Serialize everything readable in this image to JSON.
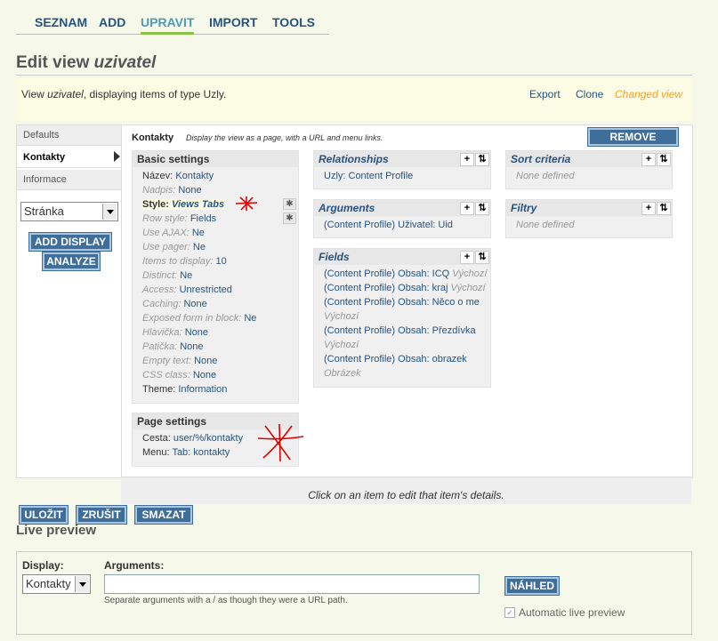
{
  "top_tabs": [
    "SEZNAM",
    "ADD",
    "UPRAVIT",
    "IMPORT",
    "TOOLS"
  ],
  "title_prefix": "Edit view ",
  "title_view": "uzivatel",
  "info": {
    "prefix": "View ",
    "view": "uzivatel",
    "suffix": ", displaying items of type Uzly.",
    "export": "Export",
    "clone": "Clone",
    "changed": "Changed view"
  },
  "displays": {
    "defaults": "Defaults",
    "kontakty": "Kontakty",
    "informace": "Informace",
    "select_value": "Stránka",
    "add_display": "ADD DISPLAY",
    "analyze": "ANALYZE"
  },
  "display_header": {
    "name": "Kontakty",
    "description": "Display the view as a page, with a URL and menu links.",
    "remove": "REMOVE DISPLAY"
  },
  "basic_settings": {
    "title": "Basic settings",
    "rows": [
      {
        "key": "Název:",
        "value": "Kontakty",
        "override": true
      },
      {
        "key": "Nadpis:",
        "value": "None",
        "override": false
      },
      {
        "key": "Style:",
        "value": "Views Tabs",
        "override": true
      },
      {
        "key": "Row style:",
        "value": "Fields",
        "override": false
      },
      {
        "key": "Use AJAX:",
        "value": "Ne",
        "override": false
      },
      {
        "key": "Use pager:",
        "value": "Ne",
        "override": false
      },
      {
        "key": "Items to display:",
        "value": "10",
        "override": false
      },
      {
        "key": "Distinct:",
        "value": "Ne",
        "override": false
      },
      {
        "key": "Access:",
        "value": "Unrestricted",
        "override": false
      },
      {
        "key": "Caching:",
        "value": "None",
        "override": false
      },
      {
        "key": "Exposed form in block:",
        "value": "Ne",
        "override": false
      },
      {
        "key": "Hlavička:",
        "value": "None",
        "override": false
      },
      {
        "key": "Patička:",
        "value": "None",
        "override": false
      },
      {
        "key": "Empty text:",
        "value": "None",
        "override": false
      },
      {
        "key": "CSS class:",
        "value": "None",
        "override": false
      },
      {
        "key": "Theme:",
        "value": "Information",
        "override": true
      }
    ]
  },
  "page_settings": {
    "title": "Page settings",
    "rows": [
      {
        "key": "Cesta:",
        "value": "user/%/kontakty"
      },
      {
        "key": "Menu:",
        "value": "Tab: kontakty"
      }
    ]
  },
  "relationships": {
    "title": "Relationships",
    "items": [
      "Uzly: Content Profile"
    ]
  },
  "arguments": {
    "title": "Arguments",
    "items": [
      "(Content Profile) Uživatel: Uid"
    ]
  },
  "fields": {
    "title": "Fields",
    "items": [
      {
        "link": "(Content Profile) Obsah: ICQ",
        "extra": "Výchozí"
      },
      {
        "link": "(Content Profile) Obsah: kraj",
        "extra": "Výchozí"
      },
      {
        "link": "(Content Profile) Obsah: Něco o me",
        "extra": "Výchozí"
      },
      {
        "link": "(Content Profile) Obsah: Přezdívka",
        "extra": "Výchozí"
      },
      {
        "link": "(Content Profile) Obsah: obrazek",
        "extra": "Obrázek"
      }
    ]
  },
  "sort_criteria": {
    "title": "Sort criteria",
    "empty": "None defined"
  },
  "filters": {
    "title": "Filtry",
    "empty": "None defined"
  },
  "footer_message": "Click on an item to edit that item's details.",
  "buttons": {
    "save": "ULOŽIT",
    "cancel": "ZRUŠIT",
    "delete": "SMAZAT"
  },
  "live_preview": {
    "title": "Live preview",
    "display_label": "Display:",
    "display_value": "Kontakty",
    "arguments_label": "Arguments:",
    "arguments_value": "",
    "hint": "Separate arguments with a / as though they were a URL path.",
    "preview_button": "NÁHLED",
    "auto_label": "Automatic live preview",
    "auto_checked": true
  },
  "colors": {
    "link": "#27537f",
    "active_tab": "#4e9bb8",
    "changed": "#f0a030",
    "button": "#3f6e9a",
    "annotation": "#e00000"
  }
}
